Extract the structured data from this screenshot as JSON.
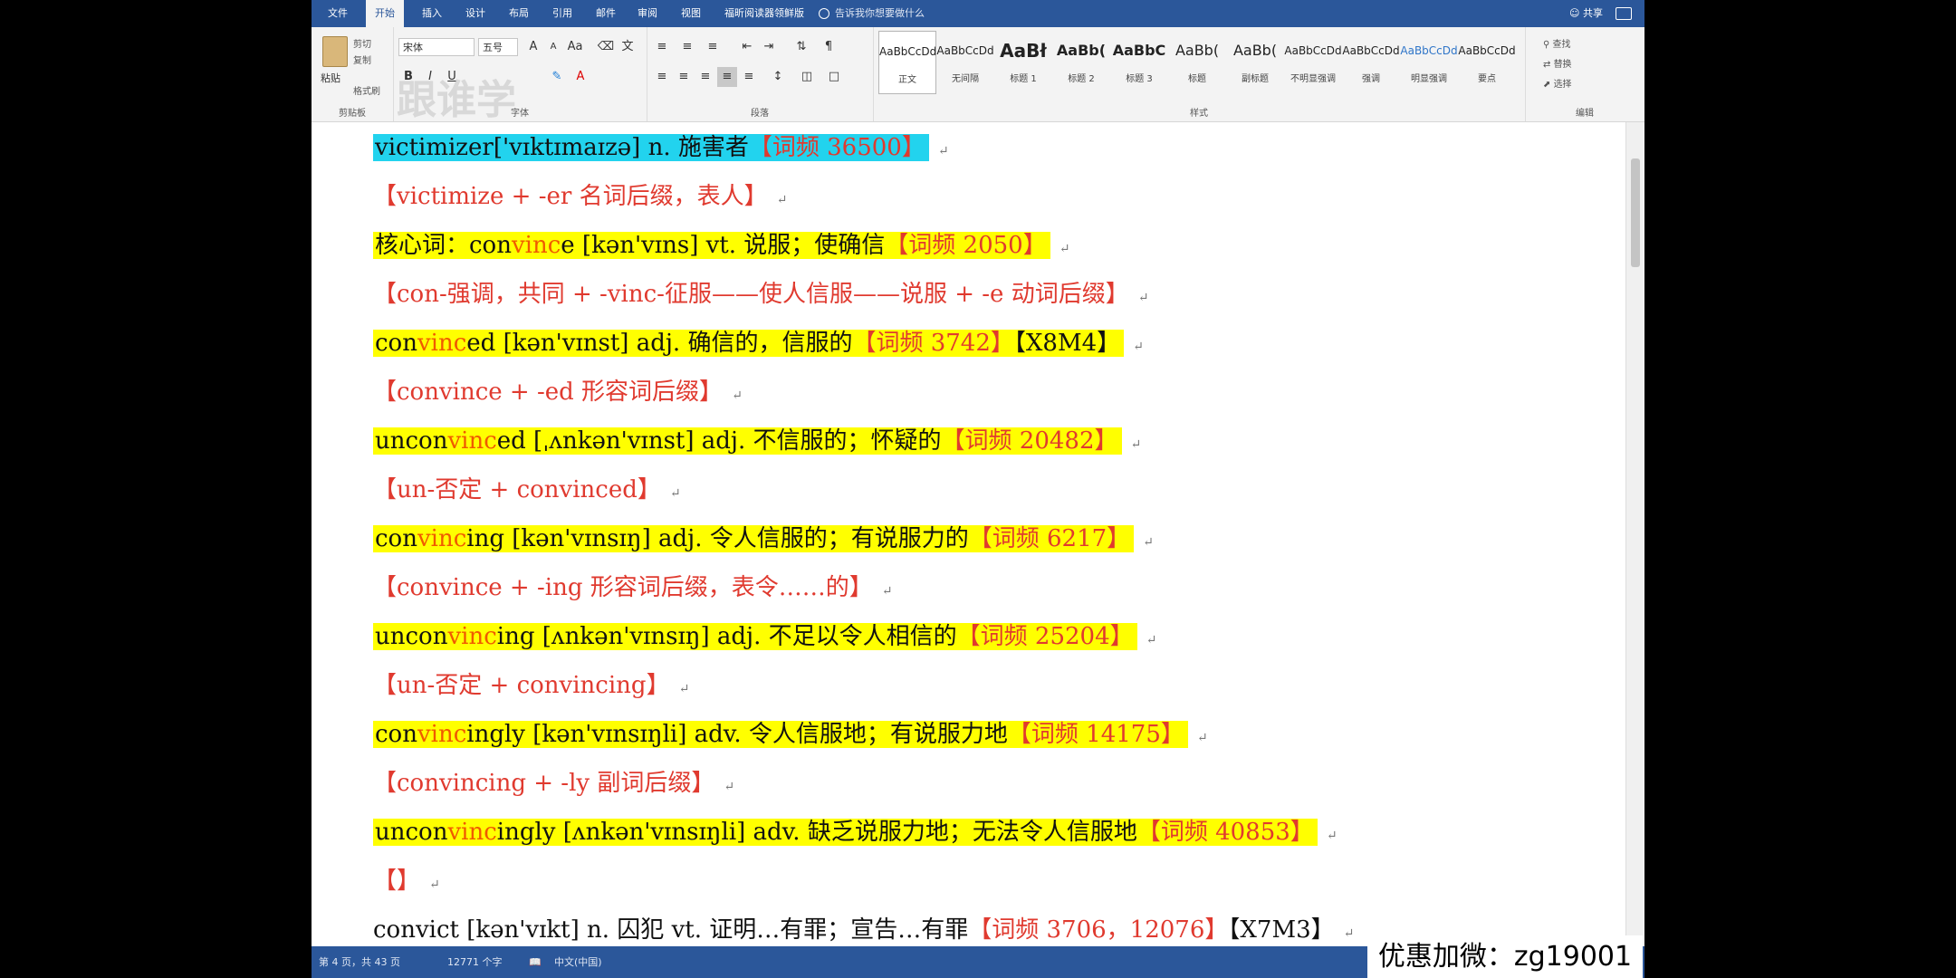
{
  "tabs": [
    "文件",
    "开始",
    "插入",
    "设计",
    "布局",
    "引用",
    "邮件",
    "审阅",
    "视图",
    "福昕阅读器领鲜版"
  ],
  "active_tab": "开始",
  "tell_me": "告诉我你想要做什么",
  "share": "共享",
  "ribbon": {
    "clipboard": {
      "paste": "粘贴",
      "cut": "剪切",
      "copy": "复制",
      "format_painter": "格式刷",
      "label": "剪贴板"
    },
    "font": {
      "name": "宋体",
      "size": "五号",
      "label": "字体"
    },
    "paragraph": {
      "label": "段落"
    },
    "styles": {
      "label": "样式",
      "items": [
        {
          "preview": "AaBbCcDd",
          "name": "正文"
        },
        {
          "preview": "AaBbCcDd",
          "name": "无间隔"
        },
        {
          "preview": "AaBł",
          "name": "标题 1"
        },
        {
          "preview": "AaBb(",
          "name": "标题 2"
        },
        {
          "preview": "AaBbC",
          "name": "标题 3"
        },
        {
          "preview": "AaBb(",
          "name": "标题"
        },
        {
          "preview": "AaBb(",
          "name": "副标题"
        },
        {
          "preview": "AaBbCcDd",
          "name": "不明显强调"
        },
        {
          "preview": "AaBbCcDd",
          "name": "强调"
        },
        {
          "preview": "AaBbCcDd",
          "name": "明显强调"
        },
        {
          "preview": "AaBbCcDd",
          "name": "要点"
        }
      ]
    },
    "editing": {
      "find": "查找",
      "replace": "替换",
      "select": "选择",
      "label": "编辑"
    }
  },
  "watermark": "跟谁学",
  "document_lines": [
    {
      "hl": "cyan",
      "segs": [
        {
          "t": "victimizer['vɪktɪmaɪzə] n.  施害者"
        },
        {
          "t": "【词频 36500】",
          "c": "red"
        }
      ]
    },
    {
      "hl": "none",
      "segs": [
        {
          "t": "【victimize + -er 名词后缀，表人】",
          "c": "red"
        }
      ]
    },
    {
      "hl": "yellow",
      "segs": [
        {
          "t": "核心词：con"
        },
        {
          "t": "vinc",
          "c": "orange"
        },
        {
          "t": "e [kən'vɪns] vt.  说服；使确信"
        },
        {
          "t": "【词频 2050】",
          "c": "red"
        }
      ]
    },
    {
      "hl": "none",
      "segs": [
        {
          "t": "【con-强调，共同 + -vinc-征服——使人信服——说服 + -e 动词后缀】",
          "c": "red"
        }
      ]
    },
    {
      "hl": "yellow",
      "segs": [
        {
          "t": "con"
        },
        {
          "t": "vinc",
          "c": "orange"
        },
        {
          "t": "ed [kən'vɪnst] adj.  确信的，信服的"
        },
        {
          "t": "【词频 3742】",
          "c": "red"
        },
        {
          "t": "【X8M4】"
        }
      ]
    },
    {
      "hl": "none",
      "segs": [
        {
          "t": "【convince + -ed 形容词后缀】",
          "c": "red"
        }
      ]
    },
    {
      "hl": "yellow",
      "segs": [
        {
          "t": "uncon"
        },
        {
          "t": "vinc",
          "c": "orange"
        },
        {
          "t": "ed [ˌʌnkən'vɪnst] adj.  不信服的；怀疑的"
        },
        {
          "t": "【词频 20482】",
          "c": "red"
        }
      ]
    },
    {
      "hl": "none",
      "segs": [
        {
          "t": "【un-否定 + convinced】",
          "c": "red"
        }
      ]
    },
    {
      "hl": "yellow",
      "segs": [
        {
          "t": "con"
        },
        {
          "t": "vinc",
          "c": "orange"
        },
        {
          "t": "ing [kən'vɪnsɪŋ] adj.  令人信服的；有说服力的"
        },
        {
          "t": "【词频 6217】",
          "c": "red"
        }
      ]
    },
    {
      "hl": "none",
      "segs": [
        {
          "t": "【convince + -ing 形容词后缀，表令……的】",
          "c": "red"
        }
      ]
    },
    {
      "hl": "yellow",
      "segs": [
        {
          "t": "uncon"
        },
        {
          "t": "vinc",
          "c": "orange"
        },
        {
          "t": "ing [ʌnkən'vɪnsɪŋ] adj.  不足以令人相信的"
        },
        {
          "t": "【词频 25204】",
          "c": "red"
        }
      ]
    },
    {
      "hl": "none",
      "segs": [
        {
          "t": "【un-否定 + convincing】",
          "c": "red"
        }
      ]
    },
    {
      "hl": "yellow",
      "segs": [
        {
          "t": "con"
        },
        {
          "t": "vinc",
          "c": "orange"
        },
        {
          "t": "ingly [kən'vɪnsɪŋli] adv.  令人信服地；有说服力地"
        },
        {
          "t": "【词频 14175】",
          "c": "red"
        }
      ]
    },
    {
      "hl": "none",
      "segs": [
        {
          "t": "【convincing + -ly 副词后缀】",
          "c": "red"
        }
      ]
    },
    {
      "hl": "yellow",
      "segs": [
        {
          "t": "uncon"
        },
        {
          "t": "vinc",
          "c": "orange"
        },
        {
          "t": "ingly [ʌnkən'vɪnsɪŋli] adv.  缺乏说服力地；无法令人信服地"
        },
        {
          "t": "【词频 40853】",
          "c": "red"
        }
      ]
    },
    {
      "hl": "none",
      "segs": [
        {
          "t": "【】",
          "c": "red"
        }
      ]
    },
    {
      "hl": "none",
      "segs": [
        {
          "t": "convict [kən'vɪkt] n.  囚犯 vt.  证明…有罪；宣告…有罪"
        },
        {
          "t": "【词频 3706，12076】",
          "c": "red"
        },
        {
          "t": "【X7M3】"
        }
      ]
    }
  ],
  "status": {
    "page": "第 4 页，共 43 页",
    "words": "12771 个字",
    "lang": "中文(中国)"
  },
  "overlay_text": "优惠加微：zg19001"
}
